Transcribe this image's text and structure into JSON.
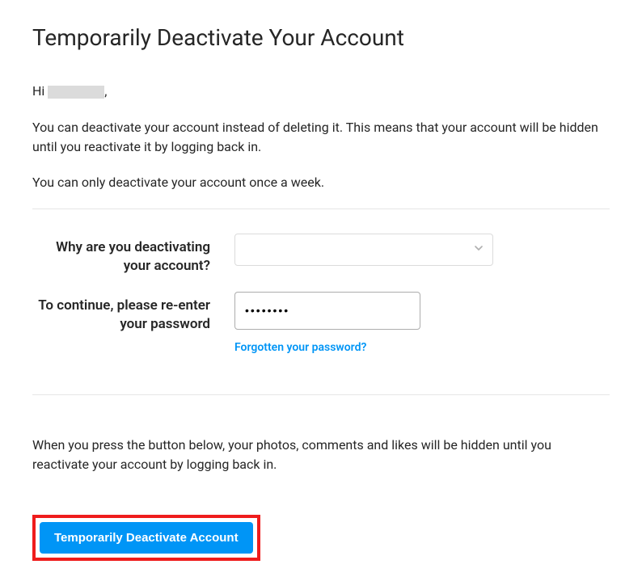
{
  "title": "Temporarily Deactivate Your Account",
  "greeting_prefix": "Hi ",
  "greeting_suffix": ",",
  "paragraph1": "You can deactivate your account instead of deleting it. This means that your account will be hidden until you reactivate it by logging back in.",
  "paragraph2": "You can only deactivate your account once a week.",
  "form": {
    "reason_label": "Why are you deactivating your account?",
    "reason_value": "",
    "password_label": "To continue, please re-enter your password",
    "password_value": "••••••••",
    "forgot_password": "Forgotten your password?"
  },
  "paragraph3": "When you press the button below, your photos, comments and likes will be hidden until you reactivate your account by logging back in.",
  "button_label": "Temporarily Deactivate Account"
}
